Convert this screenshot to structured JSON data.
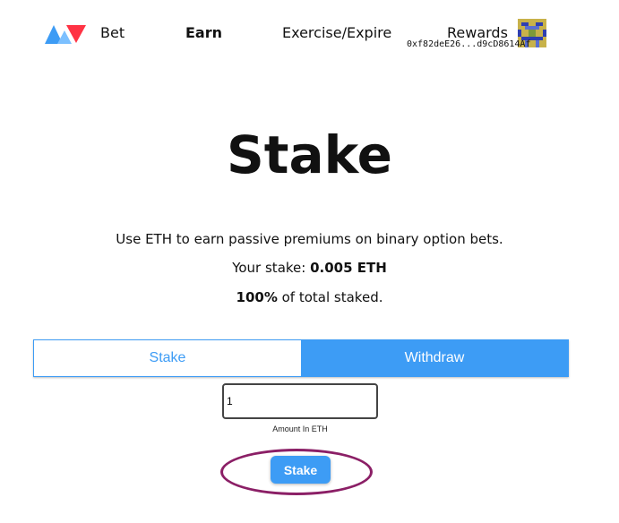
{
  "nav": {
    "links": [
      "Bet",
      "Earn",
      "Exercise/Expire",
      "Rewards"
    ],
    "active": "Earn",
    "address": "0xf82deE26...d9cD8614Af"
  },
  "main": {
    "title": "Stake",
    "description": "Use ETH to earn passive premiums on binary option bets.",
    "stake_prefix": "Your stake: ",
    "stake_value": "0.005 ETH",
    "share_value": "100%",
    "share_suffix": " of total staked."
  },
  "tabs": {
    "stake": "Stake",
    "withdraw": "Withdraw",
    "selected": "Withdraw"
  },
  "form": {
    "amount_value": "1",
    "amount_label": "Amount In ETH",
    "submit_label": "Stake"
  },
  "colors": {
    "accent": "#3d9cf5",
    "highlight": "#8b1f66",
    "logo_red": "#ff3344"
  },
  "icons": {
    "logo": "av-logo-icon",
    "avatar": "identicon-avatar"
  }
}
